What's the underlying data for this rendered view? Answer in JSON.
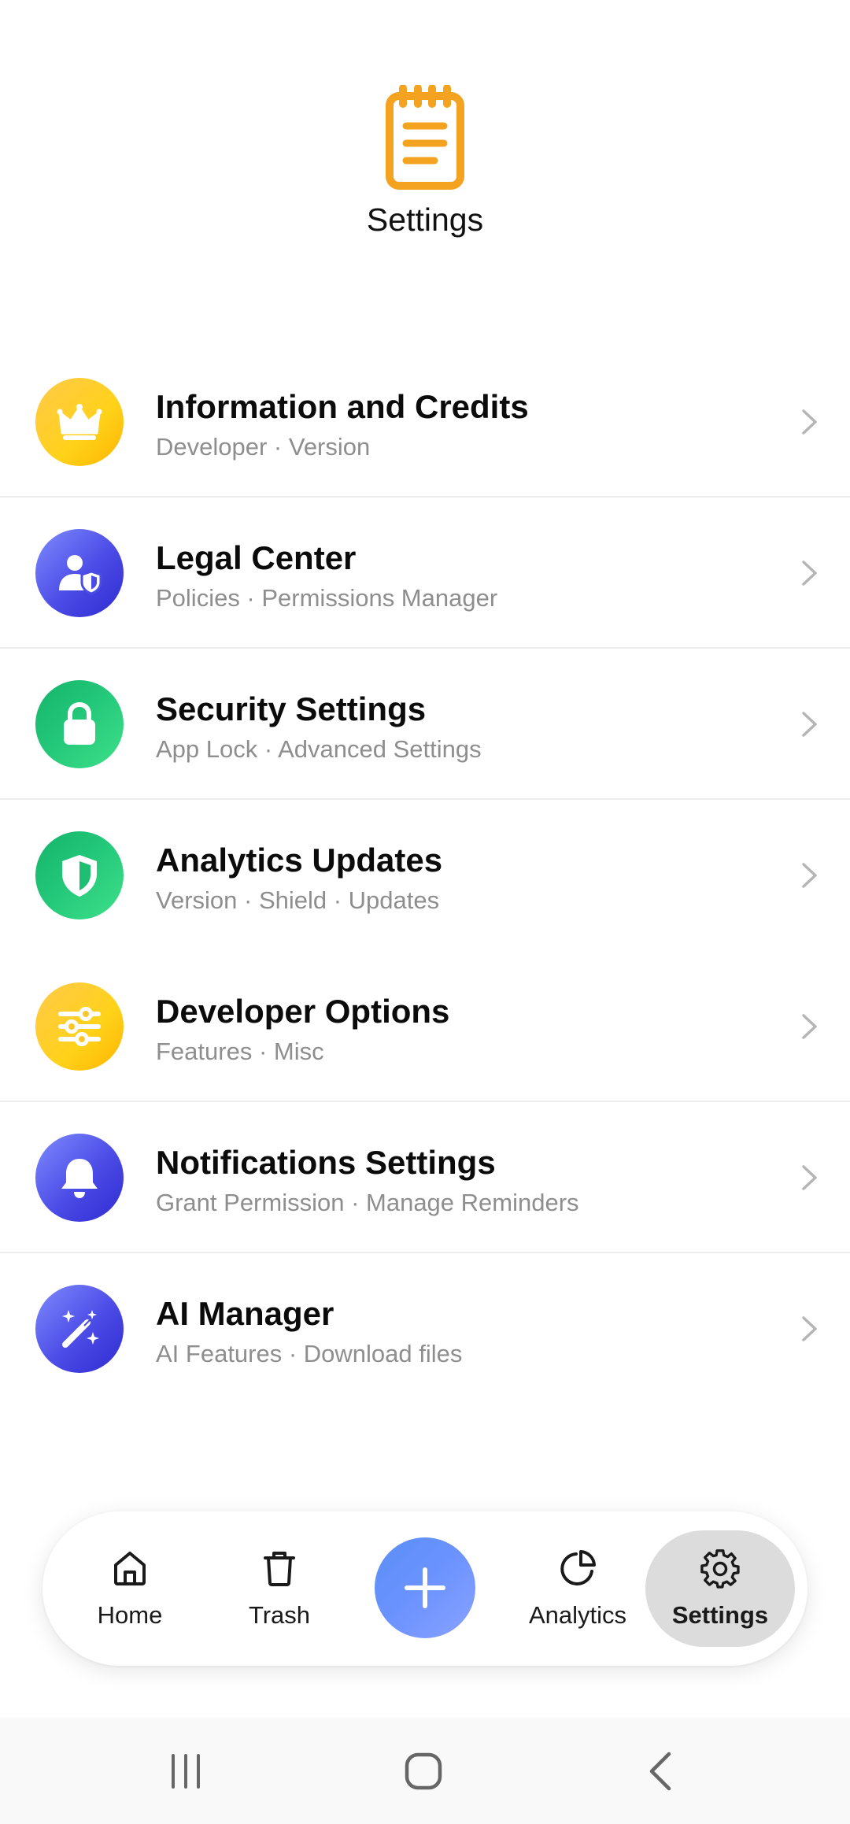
{
  "header": {
    "title": "Settings",
    "logo_icon": "notepad-icon",
    "logo_color": "#f4a321"
  },
  "settings": {
    "items": [
      {
        "title": "Information and Credits",
        "subtitle": "Developer · Version",
        "icon": "crown-icon",
        "color": "yellow"
      },
      {
        "title": "Legal Center",
        "subtitle": "Policies · Permissions Manager",
        "icon": "user-shield-icon",
        "color": "blue"
      },
      {
        "title": "Security Settings",
        "subtitle": "App Lock · Advanced Settings",
        "icon": "lock-icon",
        "color": "green"
      },
      {
        "title": "Analytics Updates",
        "subtitle": "Version · Shield · Updates",
        "icon": "shield-icon",
        "color": "green"
      },
      {
        "title": "Developer Options",
        "subtitle": "Features · Misc",
        "icon": "sliders-icon",
        "color": "yellow"
      },
      {
        "title": "Notifications Settings",
        "subtitle": "Grant Permission · Manage Reminders",
        "icon": "bell-icon",
        "color": "blue"
      },
      {
        "title": "AI Manager",
        "subtitle": "AI Features · Download files",
        "icon": "magic-wand-icon",
        "color": "blue"
      }
    ]
  },
  "nav": {
    "home_label": "Home",
    "trash_label": "Trash",
    "add_icon": "plus-icon",
    "analytics_label": "Analytics",
    "settings_label": "Settings",
    "active": "Settings"
  },
  "system_nav": {
    "recents_icon": "recents-icon",
    "home_icon": "home-circle-icon",
    "back_icon": "back-icon"
  },
  "colors": {
    "title_text": "#0b0b0b",
    "subtitle_text": "#8e8e8e",
    "divider": "#ececec",
    "fab": "#6c93ff",
    "active_nav_bg": "#dcdcdc"
  }
}
